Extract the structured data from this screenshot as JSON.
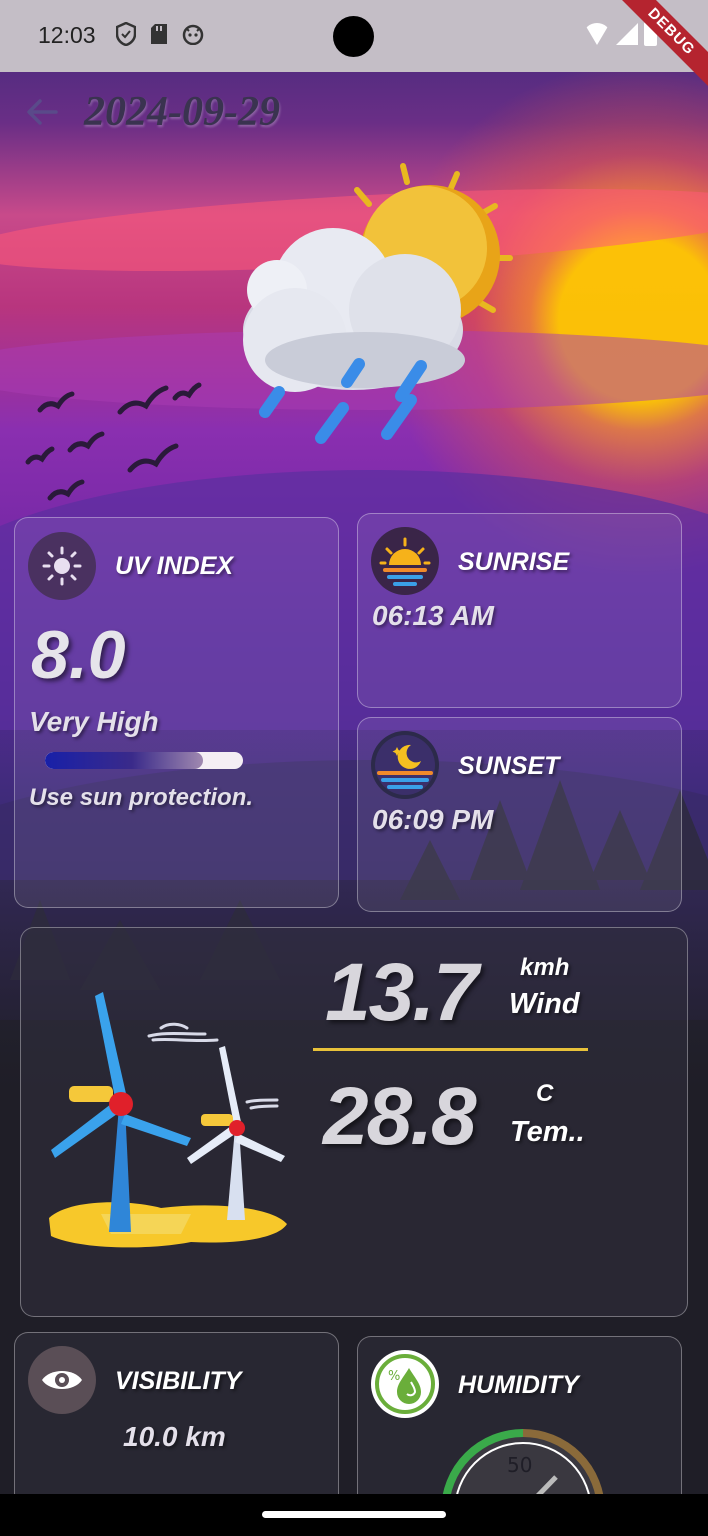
{
  "status_bar": {
    "time": "12:03",
    "left_icons": [
      "shield-icon",
      "sd-card-icon",
      "app-notification-icon"
    ],
    "right_icons": [
      "wifi-icon",
      "signal-icon",
      "battery-icon"
    ],
    "debug_label": "DEBUG"
  },
  "app_bar": {
    "back_icon": "arrow-back-icon",
    "title": "2024-09-29"
  },
  "weather_icon": "cloud-sun-rain-icon",
  "uv": {
    "title": "UV INDEX",
    "value": "8.0",
    "level": "Very High",
    "level_fraction": 0.8,
    "advice": "Use sun protection.",
    "icon": "sun-icon"
  },
  "sunrise": {
    "title": "SUNRISE",
    "time": "06:13 AM",
    "icon": "sunrise-icon"
  },
  "sunset": {
    "title": "SUNSET",
    "time": "06:09 PM",
    "icon": "sunset-moon-icon"
  },
  "wind_temp": {
    "illustration": "wind-turbines-icon",
    "wind_value": "13.7",
    "wind_unit": "kmh",
    "wind_label": "Wind",
    "temp_value": "28.8",
    "temp_unit": "C",
    "temp_label": "Tem.."
  },
  "visibility": {
    "title": "VISIBILITY",
    "value": "10.0 km",
    "icon": "eye-icon"
  },
  "humidity": {
    "title": "HUMIDITY",
    "gauge_value": "50",
    "icon": "humidity-drop-icon"
  },
  "colors": {
    "accent_yellow": "#e8c23a",
    "uv_bar_start": "#1820a8",
    "uv_bar_track": "#f4eef4"
  }
}
